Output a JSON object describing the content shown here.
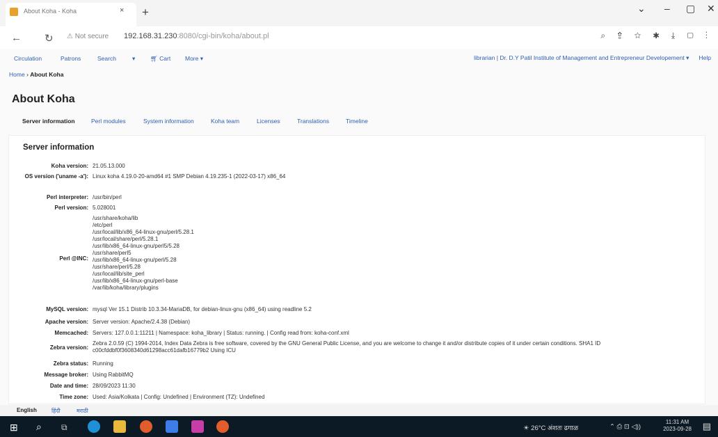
{
  "browser": {
    "tab_title": "About Koha - Koha",
    "tab_close": "×",
    "new_tab": "+",
    "window_controls": {
      "chevron": "⌄",
      "minimize": "–",
      "maximize": "▢",
      "close": "✕"
    },
    "not_secure": "Not secure",
    "url_host": "192.168.31.230",
    "url_path": ":8080/cgi-bin/koha/about.pl",
    "toolbar_icons": "⌕ ⇪ ☆ ✱ ⤓ ▢ ⋮"
  },
  "koha_nav": {
    "circulation": "Circulation",
    "patrons": "Patrons",
    "search": "Search",
    "search_dropdown": "▾",
    "cart": "Cart",
    "more": "More ▾",
    "user": "librarian",
    "sep": "|",
    "library": "Dr. D.Y Patil Institute of Management and Entrepreneur Developement ▾",
    "help": "Help"
  },
  "breadcrumb": {
    "home": "Home",
    "sep": "›",
    "current": "About Koha"
  },
  "page_title": "About Koha",
  "tabs": [
    "Server information",
    "Perl modules",
    "System information",
    "Koha team",
    "Licenses",
    "Translations",
    "Timeline"
  ],
  "section_title": "Server information",
  "server_info": {
    "koha_version": {
      "label": "Koha version:",
      "value": "21.05.13.000"
    },
    "os_version": {
      "label": "OS version ('uname -a'):",
      "value": "Linux koha 4.19.0-20-amd64 #1 SMP Debian 4.19.235-1 (2022-03-17) x86_64"
    },
    "perl_interpreter": {
      "label": "Perl interpreter:",
      "value": "/usr/bin/perl"
    },
    "perl_version": {
      "label": "Perl version:",
      "value": "5.028001"
    },
    "perl_inc": {
      "label": "Perl @INC:",
      "values": [
        "/usr/share/koha/lib",
        "/etc/perl",
        "/usr/local/lib/x86_64-linux-gnu/perl/5.28.1",
        "/usr/local/share/perl/5.28.1",
        "/usr/lib/x86_64-linux-gnu/perl5/5.28",
        "/usr/share/perl5",
        "/usr/lib/x86_64-linux-gnu/perl/5.28",
        "/usr/share/perl/5.28",
        "/usr/local/lib/site_perl",
        "/usr/lib/x86_64-linux-gnu/perl-base",
        "/var/lib/koha/library/plugins"
      ]
    },
    "mysql_version": {
      "label": "MySQL version:",
      "value": "mysql Ver 15.1 Distrib 10.3.34-MariaDB, for debian-linux-gnu (x86_64) using readline 5.2"
    },
    "apache_version": {
      "label": "Apache version:",
      "value": "Server version: Apache/2.4.38 (Debian)"
    },
    "memcached": {
      "label": "Memcached:",
      "value": "Servers: 127.0.0.1:11211 | Namespace: koha_library | Status: running. | Config read from: koha-conf.xml"
    },
    "zebra_version": {
      "label": "Zebra version:",
      "line1": "Zebra 2.0.59 (C) 1994-2014, Index Data Zebra is free software, covered by the GNU General Public License, and you are welcome to change it and/or distribute copies of it under certain conditions. SHA1 ID",
      "line2": "c00cfddbf0f3608340d61298acc61dafb16779b2 Using ICU"
    },
    "zebra_status": {
      "label": "Zebra status:",
      "value": "Running"
    },
    "message_broker": {
      "label": "Message broker:",
      "value": "Using RabbitMQ"
    },
    "date_time": {
      "label": "Date and time:",
      "value": "28/09/2023 11:30"
    },
    "time_zone": {
      "label": "Time zone:",
      "value": "Used: Asia/Kolkata | Config: Undefined | Environment (TZ): Undefined"
    }
  },
  "languages": {
    "english": "English",
    "hindi": "हिंदी",
    "marathi": "मराठी"
  },
  "taskbar": {
    "weather": "26°C अंशतः ढगाळ",
    "tray_icons": "⌃ ⎙ ⊡ ◁))",
    "time": "11:31 AM",
    "date": "2023-09-28",
    "notification": "▤"
  },
  "colors": {
    "link": "#2f5fb3",
    "taskbar": "#0c1a26",
    "favicon": "#e8a12b"
  }
}
